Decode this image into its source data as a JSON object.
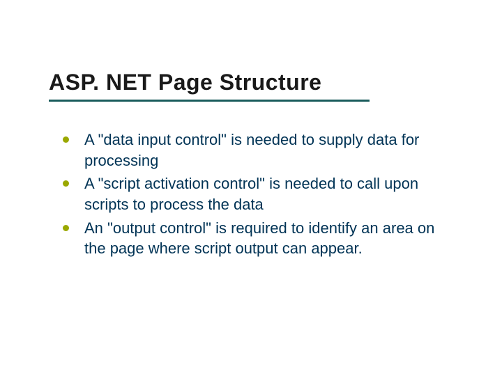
{
  "title": "ASP. NET Page Structure",
  "bullets": {
    "0": "A \"data input control\" is needed to supply data for processing",
    "1": "A \"script activation control\" is needed to call upon scripts to process the data",
    "2": "An \"output control\" is required to identify an area on the page where script output can appear."
  }
}
